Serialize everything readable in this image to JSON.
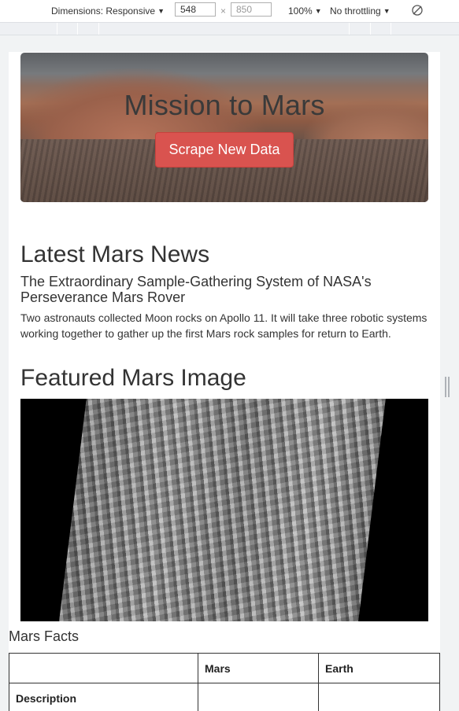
{
  "devtools": {
    "dimensions_label": "Dimensions: Responsive",
    "width": "548",
    "height_placeholder": "850",
    "times": "×",
    "zoom": "100%",
    "throttling": "No throttling",
    "caret": "▼",
    "rotate_icon": "rotate-icon"
  },
  "jumbotron": {
    "title": "Mission to Mars",
    "button_label": "Scrape New Data",
    "button_color": "#d9534f"
  },
  "news": {
    "heading": "Latest Mars News",
    "title": "The Extraordinary Sample-Gathering System of NASA's Perseverance Mars Rover",
    "paragraph": "Two astronauts collected Moon rocks on Apollo 11. It will take three robotic systems working together to gather up the first Mars rock samples for return to Earth."
  },
  "featured": {
    "heading": "Featured Mars Image"
  },
  "facts": {
    "heading": "Mars Facts",
    "columns": [
      "",
      "Mars",
      "Earth"
    ],
    "rows": [
      {
        "label": "Description",
        "mars": "",
        "earth": ""
      }
    ]
  }
}
